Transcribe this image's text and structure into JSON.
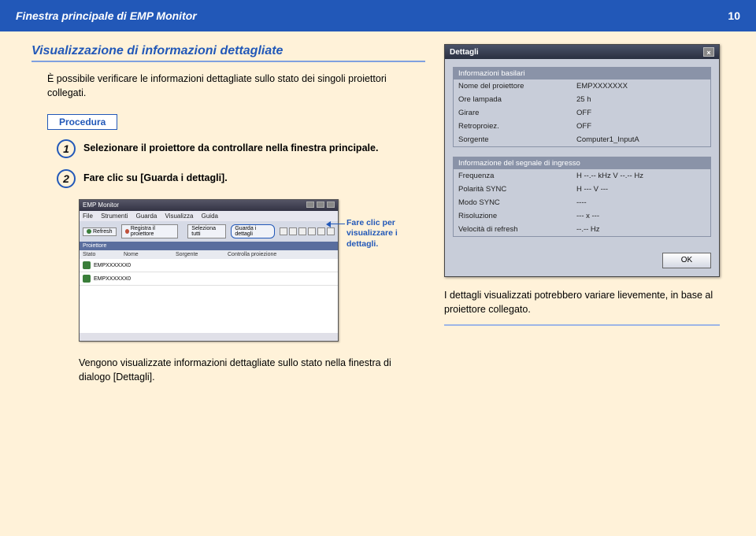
{
  "header": {
    "title": "Finestra principale di EMP Monitor",
    "page_num": "10"
  },
  "section": {
    "title": "Visualizzazione di informazioni dettagliate",
    "intro": "È possibile verificare le informazioni dettagliate sullo stato dei singoli proiettori collegati.",
    "procedure_label": "Procedura",
    "steps": [
      {
        "num": "1",
        "text": "Selezionare il proiettore da controllare nella finestra principale."
      },
      {
        "num": "2",
        "text": "Fare clic su [Guarda i dettagli]."
      }
    ]
  },
  "main_window": {
    "title": "EMP Monitor",
    "menu": [
      "File",
      "Strumenti",
      "Guarda",
      "Visualizza",
      "Guida"
    ],
    "toolbar": {
      "refresh": "Refresh",
      "reg": "Registra il proiettore",
      "sel": "Seleziona tutti",
      "guarda": "Guarda i dettagli",
      "contr": "Controlla proiezione"
    },
    "cols": {
      "c1": "Proiettore",
      "c2": "Stato",
      "c2b": "Nome",
      "c3": "Sorgente"
    },
    "rows": [
      {
        "name": "EMPXXXXXX0"
      },
      {
        "name": "EMPXXXXXX0"
      }
    ]
  },
  "callout": "Fare clic per visualizzare i dettagli.",
  "result_note": "Vengono visualizzate informazioni dettagliate sullo stato nella finestra di dialogo [Dettagli].",
  "dialog": {
    "title": "Dettagli",
    "ok": "OK",
    "group1": {
      "title": "Informazioni basilari",
      "rows": [
        {
          "label": "Nome del proiettore",
          "value": "EMPXXXXXXX"
        },
        {
          "label": "Ore lampada",
          "value": "25 h"
        },
        {
          "label": "Girare",
          "value": "OFF"
        },
        {
          "label": "Retroproiez.",
          "value": "OFF"
        },
        {
          "label": "Sorgente",
          "value": "Computer1_InputA"
        }
      ]
    },
    "group2": {
      "title": "Informazione del segnale di ingresso",
      "rows": [
        {
          "label": "Frequenza",
          "value": "H --.-- kHz  V --.-- Hz"
        },
        {
          "label": "Polarità SYNC",
          "value": "H ---  V ---"
        },
        {
          "label": "Modo SYNC",
          "value": "----"
        },
        {
          "label": "Risoluzione",
          "value": "--- x ---"
        },
        {
          "label": "Velocità di refresh",
          "value": "--.-- Hz"
        }
      ]
    }
  },
  "right_note": "I dettagli visualizzati potrebbero variare lievemente, in base al proiettore collegato."
}
